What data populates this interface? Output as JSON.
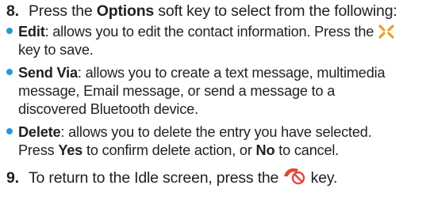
{
  "step8": {
    "number": "8.",
    "pre": "Press the ",
    "bold": "Options",
    "post": " soft key to select from the following:"
  },
  "bullets": {
    "edit": {
      "term": "Edit",
      "line1": ": allows you to edit the contact information. Press the ",
      "line2": "key to save."
    },
    "send_via": {
      "term": "Send Via",
      "line1": ": allows you to create a text message, multimedia",
      "line2": "message, Email message, or send a message to a",
      "line3": "discovered Bluetooth device."
    },
    "delete": {
      "term": "Delete",
      "line1": ": allows you to delete the entry you have selected.",
      "line2_pre": "Press ",
      "yes": "Yes",
      "line2_mid": " to confirm delete action, or ",
      "no": "No",
      "line2_post": " to cancel."
    }
  },
  "step9": {
    "number": "9.",
    "pre": "To return to the Idle screen, press the ",
    "post": " key."
  },
  "icons": {
    "save_key": "save-key-icon",
    "end_key": "end-call-key-icon"
  },
  "colors": {
    "bullet": "#2a98d8",
    "save_key_orange": "#f29a1f",
    "end_key_red": "#e2463a",
    "text": "#231f20"
  }
}
